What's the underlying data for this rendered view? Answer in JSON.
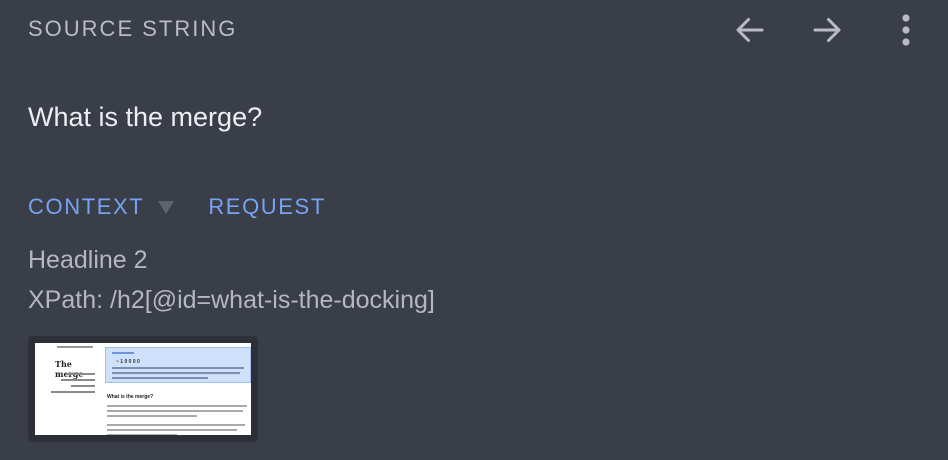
{
  "header": {
    "title": "SOURCE STRING",
    "back_icon": "arrow-left-icon",
    "forward_icon": "arrow-right-icon",
    "more_icon": "more-vertical-icon"
  },
  "source": {
    "text": "What is the merge?"
  },
  "tabs": [
    {
      "label": "CONTEXT"
    },
    {
      "label": "REQUEST"
    }
  ],
  "context": {
    "element_type": "Headline 2",
    "xpath": "XPath: /h2[@id=what-is-the-docking]"
  },
  "thumbnail": {
    "title": "The merge",
    "banner_heading": "~ 1 0 0 0 0",
    "section_heading": "What is the merge?"
  },
  "colors": {
    "background": "#3a3e48",
    "accent": "#78a2f2",
    "text": "#eceef2",
    "muted": "#b4b7bf"
  }
}
